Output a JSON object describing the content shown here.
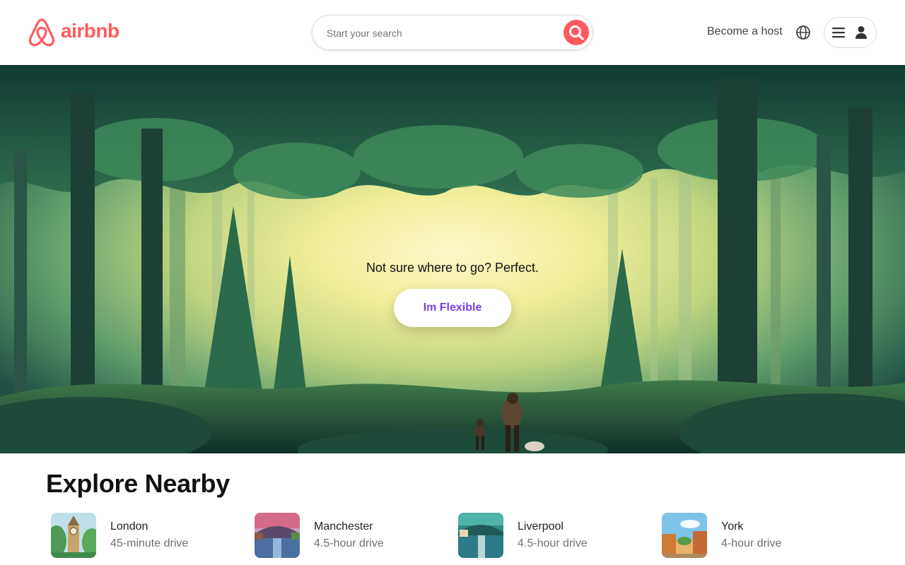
{
  "header": {
    "logo_text": "airbnb",
    "search_placeholder": "Start your search",
    "become_host": "Become a host"
  },
  "hero": {
    "tagline": "Not sure where to go? Perfect.",
    "button_label": "Im Flexible"
  },
  "explore": {
    "title": "Explore Nearby",
    "items": [
      {
        "city": "London",
        "drive": "45-minute drive"
      },
      {
        "city": "Manchester",
        "drive": "4.5-hour drive"
      },
      {
        "city": "Liverpool",
        "drive": "4.5-hour drive"
      },
      {
        "city": "York",
        "drive": "4-hour drive"
      }
    ]
  },
  "colors": {
    "brand": "#ff5a5f",
    "flexible_text": "#7b3fe4"
  },
  "icons": [
    "airbnb-logo-icon",
    "search-icon",
    "globe-icon",
    "hamburger-menu-icon",
    "user-icon"
  ]
}
